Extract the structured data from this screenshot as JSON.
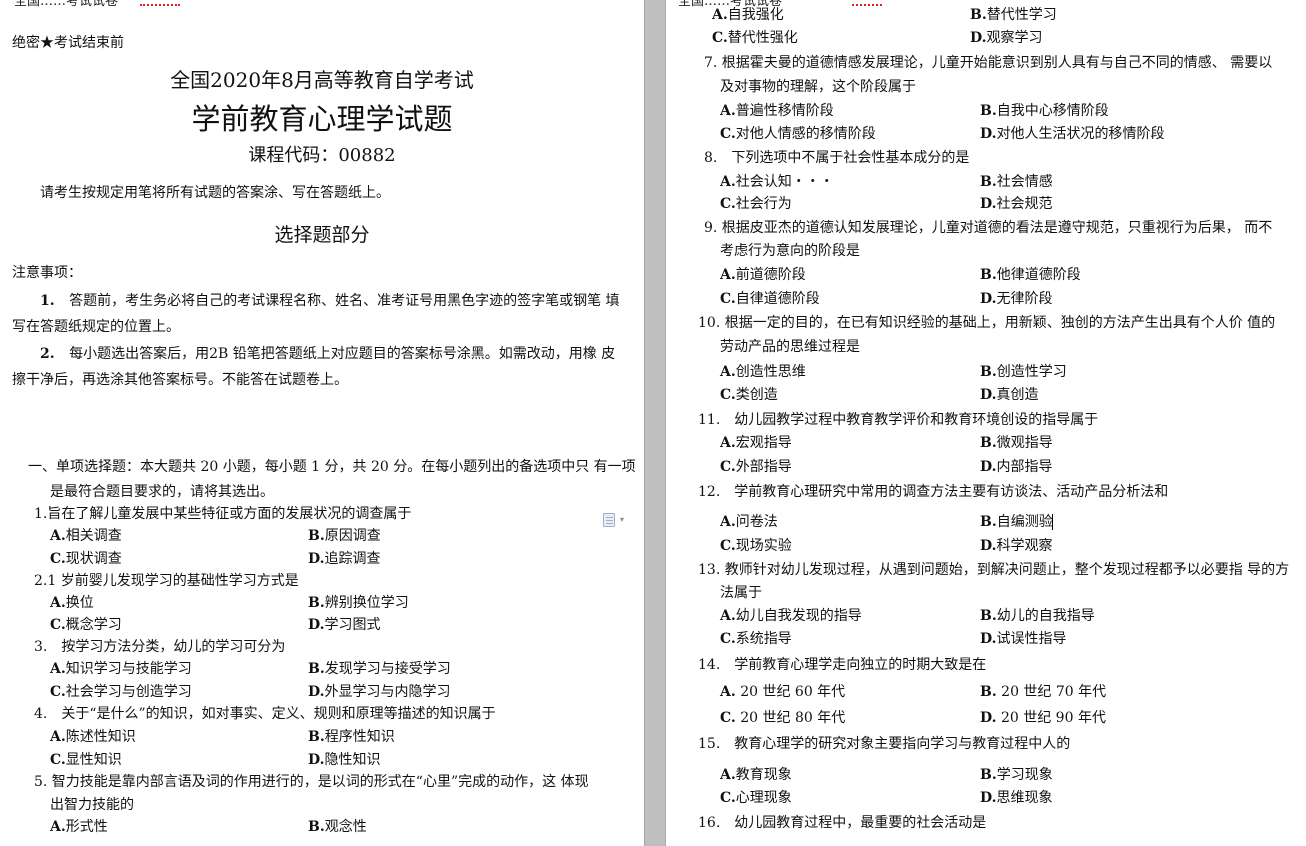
{
  "left_page": {
    "top_cut_text": "全国……考试试卷",
    "confidential": "绝密★考试结束前",
    "exam_title": "全国2020年8月高等教育自学考试",
    "subject_title": "学前教育心理学试题",
    "course_code": "课程代码：00882",
    "instruction": "请考生按规定用笔将所有试题的答案涂、写在答题纸上。",
    "section_heading": "选择题部分",
    "notes_heading": "注意事项：",
    "notes": [
      {
        "num": "1.",
        "line1": "答题前，考生务必将自己的考试课程名称、姓名、准考证号用黑色字迹的签字笔或钢笔 填",
        "line2": "写在答题纸规定的位置上。"
      },
      {
        "num": "2.",
        "line1": "每小题选出答案后，用2B 铅笔把答题纸上对应题目的答案标号涂黑。如需改动，用橡 皮",
        "line2": "擦干净后，再选涂其他答案标号。不能答在试题卷上。"
      }
    ],
    "part_one_line1": "一、单项选择题：本大题共 20 小题，每小题 1 分，共 20 分。在每小题列出的备选项中只 有一项",
    "part_one_line2": "是最符合题目要求的，请将其选出。",
    "questions": [
      {
        "stem": "1.旨在了解儿童发展中某些特征或方面的发展状况的调查属于",
        "a": "A.相关调查",
        "b": "B.原因调查",
        "c": "C.现状调查",
        "d": "D.追踪调查"
      },
      {
        "stem": "2.1 岁前婴儿发现学习的基础性学习方式是",
        "a": "A.换位",
        "b": "B.辨别换位学习",
        "c": "C.概念学习",
        "d": "D.学习图式"
      },
      {
        "stem": "3.　按学习方法分类，幼儿的学习可分为",
        "a": "A.知识学习与技能学习",
        "b": "B.发现学习与接受学习",
        "c": "C.社会学习与创造学习",
        "d": "D.外显学习与内隐学习"
      },
      {
        "stem": "4.　关于“是什么”的知识，如对事实、定义、规则和原理等描述的知识属于",
        "a": "A.陈述性知识",
        "b": "B.程序性知识",
        "c": "C.显性知识",
        "d": "D.隐性知识"
      },
      {
        "stem": "5. 智力技能是靠内部言语及词的作用进行的，是以词的形式在“心里”完成的动作，这 体现",
        "stem2": "出智力技能的",
        "a": "A.形式性",
        "b": "B.观念性"
      }
    ]
  },
  "right_page": {
    "top_cut_text": "全国……考试试卷",
    "q6_options": {
      "a": "A.自我强化",
      "b": "B.替代性学习",
      "c": "C.替代性强化",
      "d": "D.观察学习"
    },
    "questions": [
      {
        "stem": "7. 根据霍夫曼的道德情感发展理论，儿童开始能意识到别人具有与自己不同的情感、 需要以",
        "stem2": "及对事物的理解，这个阶段属于",
        "a": "A.普遍性移情阶段",
        "b": "B.自我中心移情阶段",
        "c": "C.对他人情感的移情阶段",
        "d": "D.对他人生活状况的移情阶段"
      },
      {
        "stem": "8.　下列选项中不属于社会性基本成分的是",
        "a": "A.社会认知・・・",
        "b": "B.社会情感",
        "c": "C.社会行为",
        "d": "D.社会规范"
      },
      {
        "stem": "9. 根据皮亚杰的道德认知发展理论，儿童对道德的看法是遵守规范，只重视行为后果， 而不",
        "stem2": "考虑行为意向的阶段是",
        "a": "A.前道德阶段",
        "b": "B.他律道德阶段",
        "c": "C.自律道德阶段",
        "d": "D.无律阶段"
      },
      {
        "stem": "10. 根据一定的目的，在已有知识经验的基础上，用新颖、独创的方法产生出具有个人价 值的",
        "stem2": "劳动产品的思维过程是",
        "a": "A.创造性思维",
        "b": "B.创造性学习",
        "c": "C.类创造",
        "d": "D.真创造"
      },
      {
        "stem": "11.　幼儿园教学过程中教育教学评价和教育环境创设的指导属于",
        "a": "A.宏观指导",
        "b": "B.微观指导",
        "c": "C.外部指导",
        "d": "D.内部指导"
      },
      {
        "stem": "12.　学前教育心理研究中常用的调查方法主要有访谈法、活动产品分析法和",
        "a": "A.问卷法",
        "b": "B.自编测验",
        "c": "C.现场实验",
        "d": "D.科学观察"
      },
      {
        "stem": "13. 教师针对幼儿发现过程，从遇到问题始，到解决问题止，整个发现过程都予以必要指 导的方",
        "stem2": "法属于",
        "a": "A.幼儿自我发现的指导",
        "b": "B.幼儿的自我指导",
        "c": "C.系统指导",
        "d": "D.试误性指导"
      },
      {
        "stem": "14.　学前教育心理学走向独立的时期大致是在",
        "a": "A. 20 世纪 60 年代",
        "b": "B. 20 世纪 70 年代",
        "c": "C. 20 世纪 80 年代",
        "d": "D. 20 世纪 90 年代"
      },
      {
        "stem": "15.　教育心理学的研究对象主要指向学习与教育过程中人的",
        "a": "A.教育现象",
        "b": "B.学习现象",
        "c": "C.心理现象",
        "d": "D.思维现象"
      },
      {
        "stem": "16.　幼儿园教育过程中，最重要的社会活动是"
      }
    ]
  },
  "icons": {
    "paste_options": "paste-options-icon"
  }
}
